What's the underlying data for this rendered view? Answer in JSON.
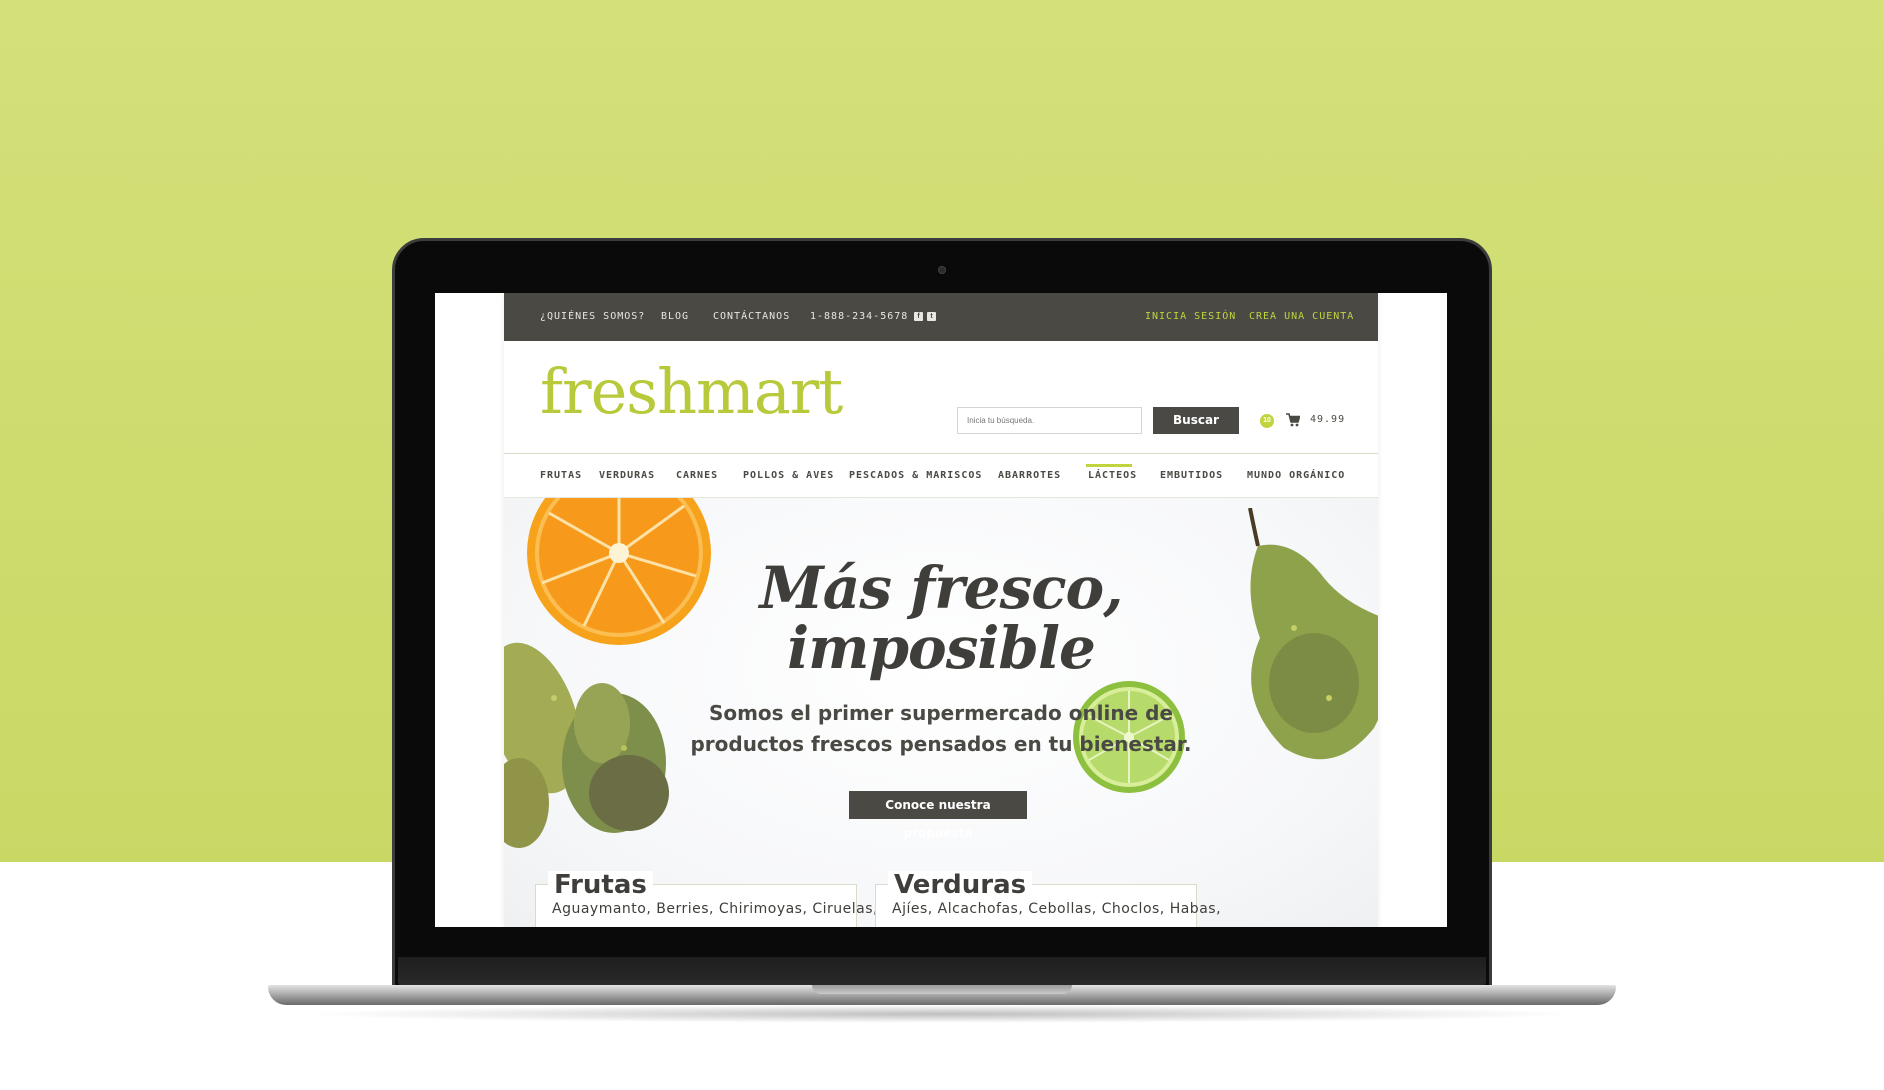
{
  "topbar": {
    "about": "¿QUIÉNES SOMOS?",
    "blog": "BLOG",
    "contact": "CONTÁCTANOS",
    "phone": "1-888-234-5678",
    "login": "INICIA SESIÓN",
    "register": "CREA UNA CUENTA"
  },
  "header": {
    "logo": "freshmart",
    "search_placeholder": "Inicia tu búsqueda.",
    "search_button": "Buscar",
    "cart_count": "10",
    "cart_total": "49.99"
  },
  "nav": {
    "items": [
      "FRUTAS",
      "VERDURAS",
      "CARNES",
      "POLLOS & AVES",
      "PESCADOS & MARISCOS",
      "ABARROTES",
      "LÁCTEOS",
      "EMBUTIDOS",
      "MUNDO ORGÁNICO"
    ],
    "active": "LÁCTEOS"
  },
  "hero": {
    "title_line1": "Más fresco,",
    "title_line2": "imposible",
    "subtitle_line1": "Somos el primer supermercado online de",
    "subtitle_line2": "productos frescos pensados en tu bienestar.",
    "cta": "Conoce nuestra propuesta"
  },
  "categories": [
    {
      "title": "Frutas",
      "text": "Aguaymanto, Berries, Chirimoyas, Ciruelas,"
    },
    {
      "title": "Verduras",
      "text": "Ajíes, Alcachofas, Cebollas, Choclos, Habas,"
    }
  ],
  "colors": {
    "accent": "#c2d43d",
    "dark": "#4a4944",
    "background": "#d4e079"
  }
}
